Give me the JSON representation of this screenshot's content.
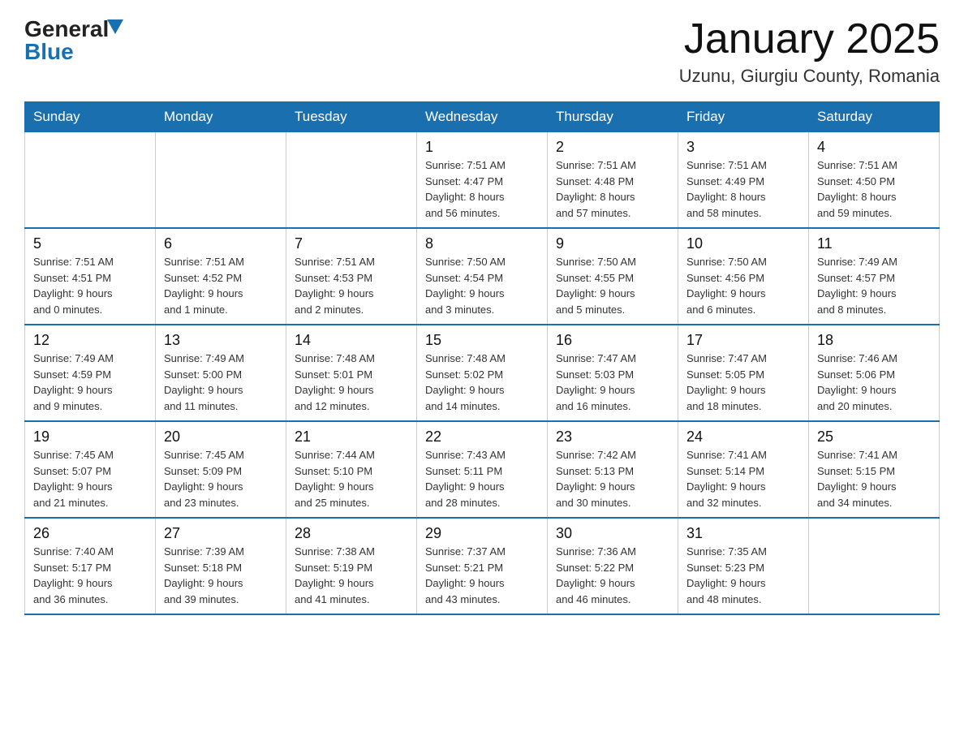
{
  "header": {
    "logo_general": "General",
    "logo_blue": "Blue",
    "title": "January 2025",
    "subtitle": "Uzunu, Giurgiu County, Romania"
  },
  "weekdays": [
    "Sunday",
    "Monday",
    "Tuesday",
    "Wednesday",
    "Thursday",
    "Friday",
    "Saturday"
  ],
  "weeks": [
    [
      {
        "day": "",
        "info": ""
      },
      {
        "day": "",
        "info": ""
      },
      {
        "day": "",
        "info": ""
      },
      {
        "day": "1",
        "info": "Sunrise: 7:51 AM\nSunset: 4:47 PM\nDaylight: 8 hours\nand 56 minutes."
      },
      {
        "day": "2",
        "info": "Sunrise: 7:51 AM\nSunset: 4:48 PM\nDaylight: 8 hours\nand 57 minutes."
      },
      {
        "day": "3",
        "info": "Sunrise: 7:51 AM\nSunset: 4:49 PM\nDaylight: 8 hours\nand 58 minutes."
      },
      {
        "day": "4",
        "info": "Sunrise: 7:51 AM\nSunset: 4:50 PM\nDaylight: 8 hours\nand 59 minutes."
      }
    ],
    [
      {
        "day": "5",
        "info": "Sunrise: 7:51 AM\nSunset: 4:51 PM\nDaylight: 9 hours\nand 0 minutes."
      },
      {
        "day": "6",
        "info": "Sunrise: 7:51 AM\nSunset: 4:52 PM\nDaylight: 9 hours\nand 1 minute."
      },
      {
        "day": "7",
        "info": "Sunrise: 7:51 AM\nSunset: 4:53 PM\nDaylight: 9 hours\nand 2 minutes."
      },
      {
        "day": "8",
        "info": "Sunrise: 7:50 AM\nSunset: 4:54 PM\nDaylight: 9 hours\nand 3 minutes."
      },
      {
        "day": "9",
        "info": "Sunrise: 7:50 AM\nSunset: 4:55 PM\nDaylight: 9 hours\nand 5 minutes."
      },
      {
        "day": "10",
        "info": "Sunrise: 7:50 AM\nSunset: 4:56 PM\nDaylight: 9 hours\nand 6 minutes."
      },
      {
        "day": "11",
        "info": "Sunrise: 7:49 AM\nSunset: 4:57 PM\nDaylight: 9 hours\nand 8 minutes."
      }
    ],
    [
      {
        "day": "12",
        "info": "Sunrise: 7:49 AM\nSunset: 4:59 PM\nDaylight: 9 hours\nand 9 minutes."
      },
      {
        "day": "13",
        "info": "Sunrise: 7:49 AM\nSunset: 5:00 PM\nDaylight: 9 hours\nand 11 minutes."
      },
      {
        "day": "14",
        "info": "Sunrise: 7:48 AM\nSunset: 5:01 PM\nDaylight: 9 hours\nand 12 minutes."
      },
      {
        "day": "15",
        "info": "Sunrise: 7:48 AM\nSunset: 5:02 PM\nDaylight: 9 hours\nand 14 minutes."
      },
      {
        "day": "16",
        "info": "Sunrise: 7:47 AM\nSunset: 5:03 PM\nDaylight: 9 hours\nand 16 minutes."
      },
      {
        "day": "17",
        "info": "Sunrise: 7:47 AM\nSunset: 5:05 PM\nDaylight: 9 hours\nand 18 minutes."
      },
      {
        "day": "18",
        "info": "Sunrise: 7:46 AM\nSunset: 5:06 PM\nDaylight: 9 hours\nand 20 minutes."
      }
    ],
    [
      {
        "day": "19",
        "info": "Sunrise: 7:45 AM\nSunset: 5:07 PM\nDaylight: 9 hours\nand 21 minutes."
      },
      {
        "day": "20",
        "info": "Sunrise: 7:45 AM\nSunset: 5:09 PM\nDaylight: 9 hours\nand 23 minutes."
      },
      {
        "day": "21",
        "info": "Sunrise: 7:44 AM\nSunset: 5:10 PM\nDaylight: 9 hours\nand 25 minutes."
      },
      {
        "day": "22",
        "info": "Sunrise: 7:43 AM\nSunset: 5:11 PM\nDaylight: 9 hours\nand 28 minutes."
      },
      {
        "day": "23",
        "info": "Sunrise: 7:42 AM\nSunset: 5:13 PM\nDaylight: 9 hours\nand 30 minutes."
      },
      {
        "day": "24",
        "info": "Sunrise: 7:41 AM\nSunset: 5:14 PM\nDaylight: 9 hours\nand 32 minutes."
      },
      {
        "day": "25",
        "info": "Sunrise: 7:41 AM\nSunset: 5:15 PM\nDaylight: 9 hours\nand 34 minutes."
      }
    ],
    [
      {
        "day": "26",
        "info": "Sunrise: 7:40 AM\nSunset: 5:17 PM\nDaylight: 9 hours\nand 36 minutes."
      },
      {
        "day": "27",
        "info": "Sunrise: 7:39 AM\nSunset: 5:18 PM\nDaylight: 9 hours\nand 39 minutes."
      },
      {
        "day": "28",
        "info": "Sunrise: 7:38 AM\nSunset: 5:19 PM\nDaylight: 9 hours\nand 41 minutes."
      },
      {
        "day": "29",
        "info": "Sunrise: 7:37 AM\nSunset: 5:21 PM\nDaylight: 9 hours\nand 43 minutes."
      },
      {
        "day": "30",
        "info": "Sunrise: 7:36 AM\nSunset: 5:22 PM\nDaylight: 9 hours\nand 46 minutes."
      },
      {
        "day": "31",
        "info": "Sunrise: 7:35 AM\nSunset: 5:23 PM\nDaylight: 9 hours\nand 48 minutes."
      },
      {
        "day": "",
        "info": ""
      }
    ]
  ]
}
